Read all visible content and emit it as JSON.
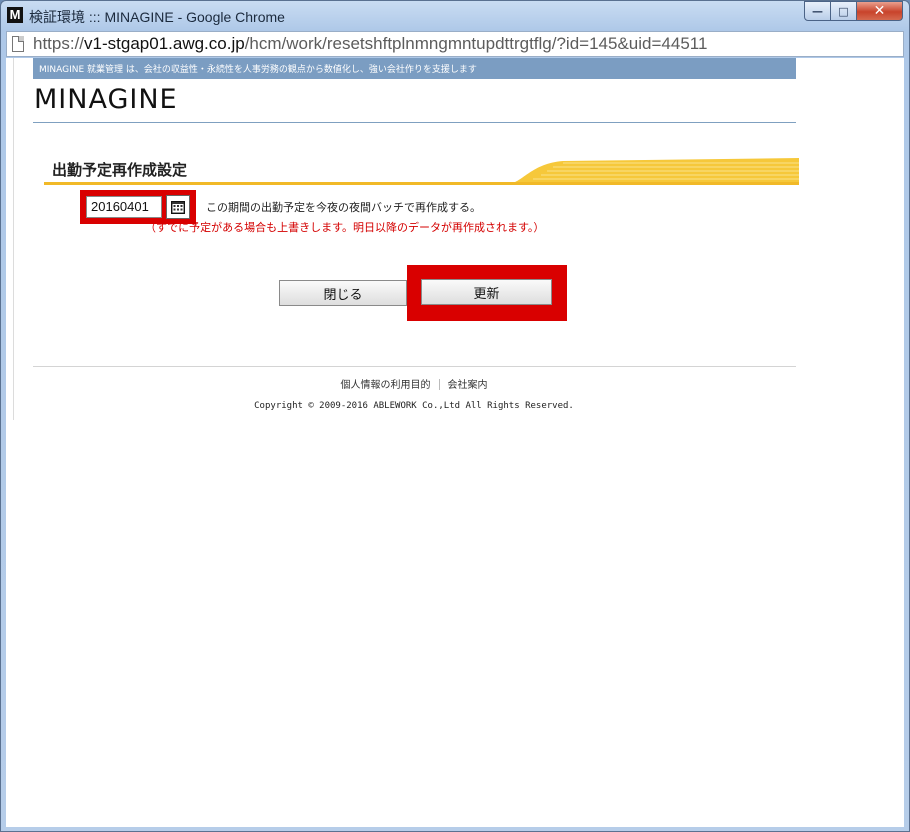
{
  "window": {
    "logo": "M",
    "title": "検証環境 ::: MINAGINE - Google Chrome",
    "minimize": "—",
    "maximize": "□",
    "close": "✕"
  },
  "address": {
    "scheme": "https://",
    "host": "v1-stgap01.awg.co.jp",
    "path": "/hcm/work/resetshftplnmngmntupdttrgtflg/?id=145&uid=44511"
  },
  "header": {
    "banner": "MINAGINE 就業管理 は、会社の収益性・永続性を人事労務の観点から数値化し、強い会社作りを支援します",
    "brand": "MINAGINE"
  },
  "form": {
    "section_title": "出勤予定再作成設定",
    "date_value": "20160401",
    "description": "この期間の出勤予定を今夜の夜間バッチで再作成する。",
    "warning": "（すでに予定がある場合も上書きします。明日以降のデータが再作成されます。）",
    "close_label": "閉じる",
    "update_label": "更新"
  },
  "footer": {
    "link_privacy": "個人情報の利用目的",
    "link_company": "会社案内",
    "copyright": "Copyright © 2009-2016 ABLEWORK Co.,Ltd All Rights Reserved."
  },
  "colors": {
    "banner": "#7b9dc2",
    "accent_yellow": "#f1b928",
    "highlight_red": "#d90000",
    "warning_text": "#d40000"
  }
}
